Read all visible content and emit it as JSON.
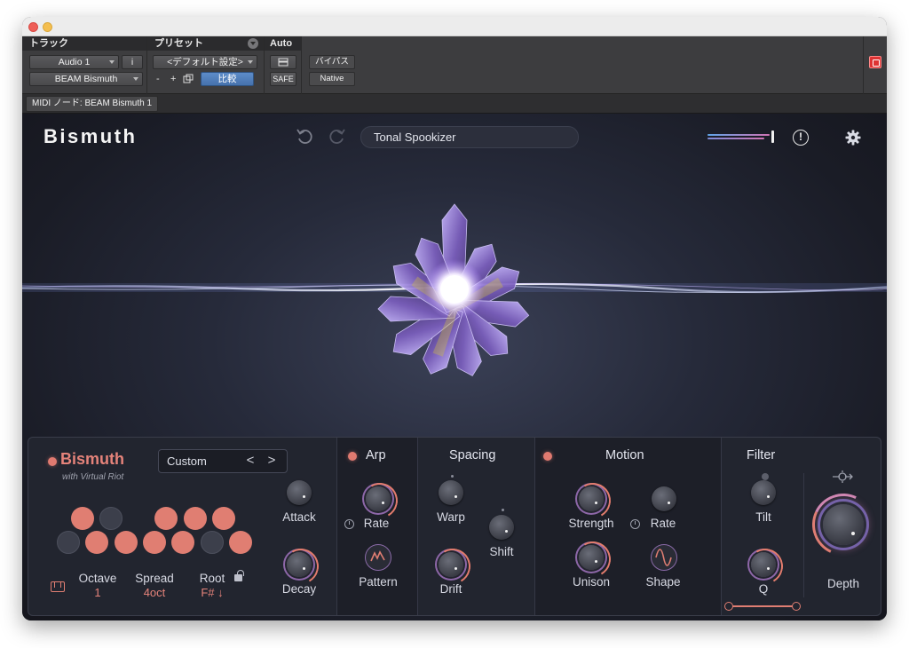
{
  "host": {
    "track": {
      "title": "トラック",
      "track_name": "Audio 1",
      "info_btn": "i",
      "plugin_name": "BEAM Bismuth"
    },
    "preset": {
      "title": "プリセット",
      "value": "<デフォルト設定>",
      "minus": "-",
      "plus": "+",
      "compare": "比較"
    },
    "auto": {
      "title": "Auto",
      "safe": "SAFE"
    },
    "bypass": "バイパス",
    "native": "Native",
    "midi_tab": "MIDI ノード: BEAM Bismuth 1"
  },
  "plugin": {
    "logo": "Bismuth",
    "preset_name": "Tonal Spookizer",
    "meter_colors": [
      "#5fa4e8",
      "#d074b4",
      "#7d8bd6"
    ],
    "main": {
      "title": "Bismuth",
      "subtitle": "with Virtual Riot",
      "selector": "Custom",
      "prev": "<",
      "next": ">",
      "attack": "Attack",
      "decay": "Decay",
      "octave_label": "Octave",
      "octave_value": "1",
      "spread_label": "Spread",
      "spread_value": "4oct",
      "root_label": "Root",
      "root_value": "F# ↓",
      "row1": [
        true,
        false,
        false,
        true,
        true,
        true
      ],
      "row2": [
        false,
        true,
        true,
        true,
        true,
        false,
        true
      ]
    },
    "arp": {
      "title": "Arp",
      "rate": "Rate",
      "pattern": "Pattern"
    },
    "spacing": {
      "title": "Spacing",
      "warp": "Warp",
      "drift": "Drift",
      "shift": "Shift"
    },
    "motion": {
      "title": "Motion",
      "strength": "Strength",
      "rate": "Rate",
      "unison": "Unison",
      "shape": "Shape"
    },
    "filter": {
      "title": "Filter",
      "tilt": "Tilt",
      "q": "Q"
    },
    "depth": "Depth",
    "accent_color": "#e07e72"
  }
}
